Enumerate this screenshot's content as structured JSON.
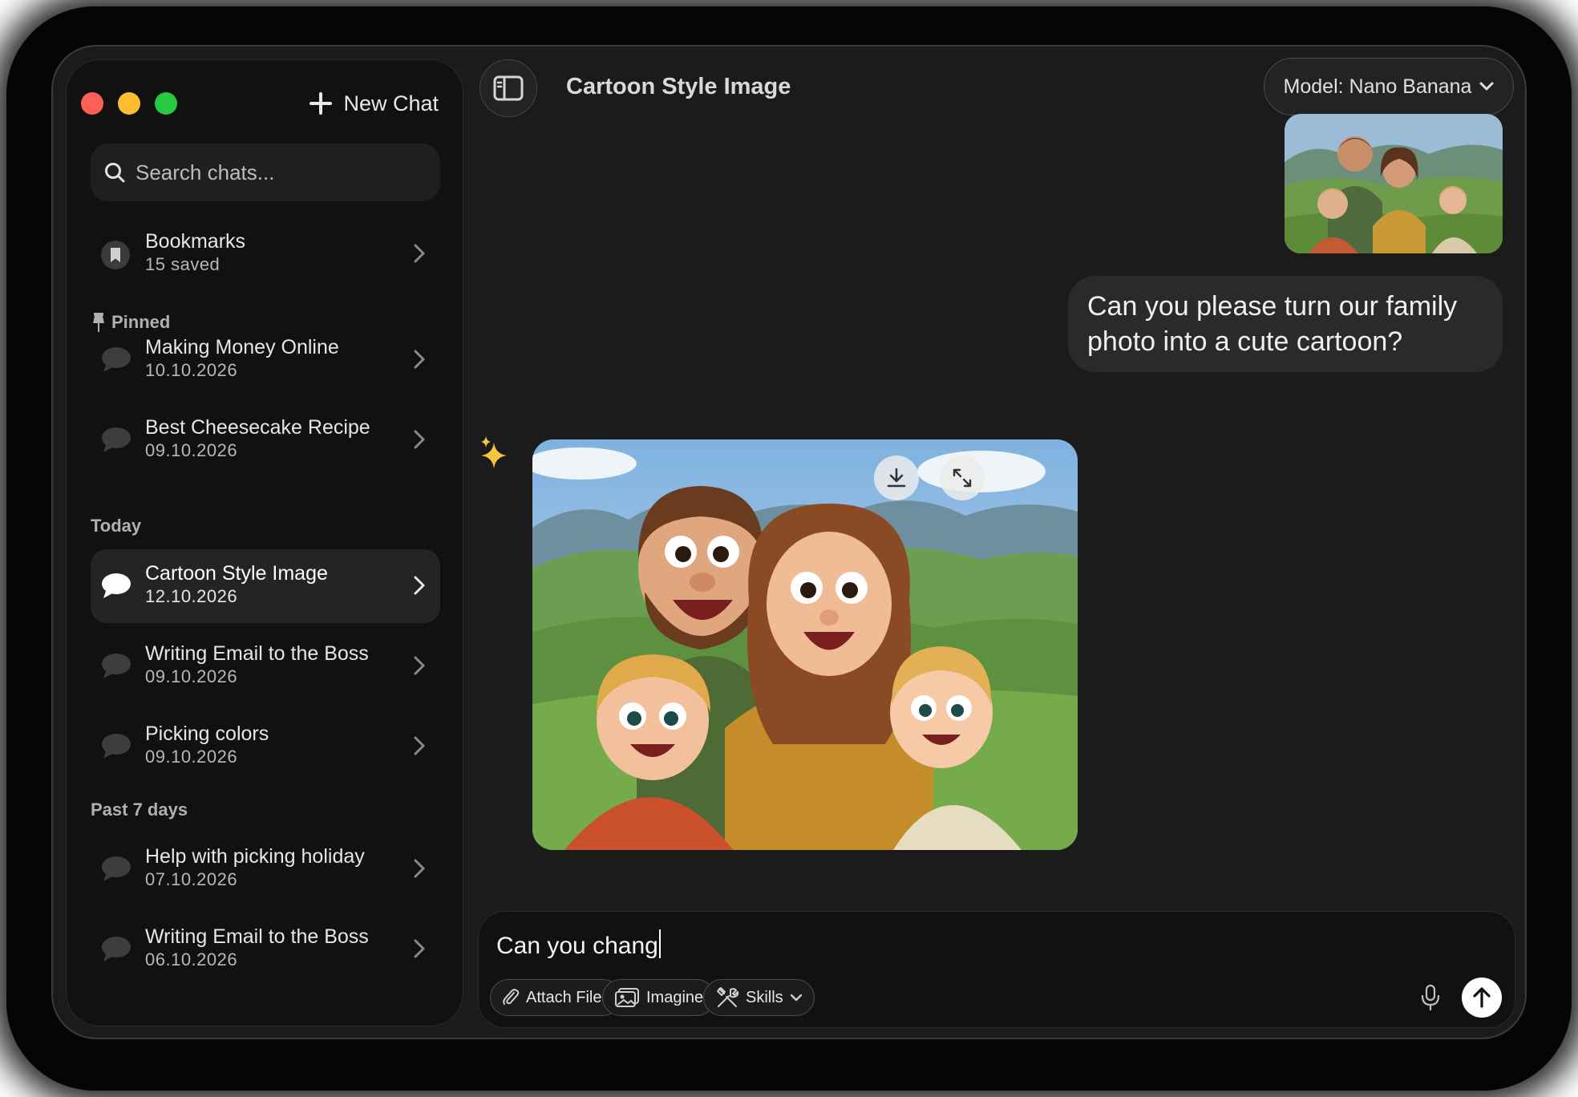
{
  "sidebar": {
    "new_chat_label": "New Chat",
    "search_placeholder": "Search chats...",
    "bookmarks": {
      "title": "Bookmarks",
      "subtitle": "15 saved"
    },
    "pinned_label": "Pinned",
    "pinned": [
      {
        "title": "Making Money Online",
        "date": "10.10.2026"
      },
      {
        "title": "Best Cheesecake Recipe",
        "date": "09.10.2026"
      }
    ],
    "today_label": "Today",
    "today": [
      {
        "title": "Cartoon Style Image",
        "date": "12.10.2026",
        "active": true
      },
      {
        "title": "Writing Email to the Boss",
        "date": "09.10.2026"
      },
      {
        "title": "Picking colors",
        "date": "09.10.2026"
      }
    ],
    "past_label": "Past 7 days",
    "past": [
      {
        "title": "Help with picking holiday",
        "date": "07.10.2026"
      },
      {
        "title": "Writing Email to the Boss",
        "date": "06.10.2026"
      }
    ]
  },
  "header": {
    "title": "Cartoon Style Image",
    "model_label": "Model: Nano Banana"
  },
  "messages": {
    "user_text": "Can you please turn our family photo into a cute cartoon?"
  },
  "composer": {
    "input_value": "Can you chang",
    "attach_label": "Attach Files",
    "imagine_label": "Imagine",
    "skills_label": "Skills"
  },
  "colors": {
    "background": "#1b1b1b",
    "sidebar": "#111111",
    "active_item": "#242424",
    "sparkle": "#f5c542",
    "traffic_red": "#fe5f57",
    "traffic_yellow": "#febc2e",
    "traffic_green": "#28c840"
  },
  "icons": [
    "search-icon",
    "plus-icon",
    "bookmark-icon",
    "pin-icon",
    "chat-bubble-icon",
    "chevron-right-icon",
    "sidebar-toggle-icon",
    "chevron-down-icon",
    "sparkle-icon",
    "download-icon",
    "expand-icon",
    "paperclip-icon",
    "image-icon",
    "tools-icon",
    "microphone-icon",
    "arrow-up-icon"
  ]
}
